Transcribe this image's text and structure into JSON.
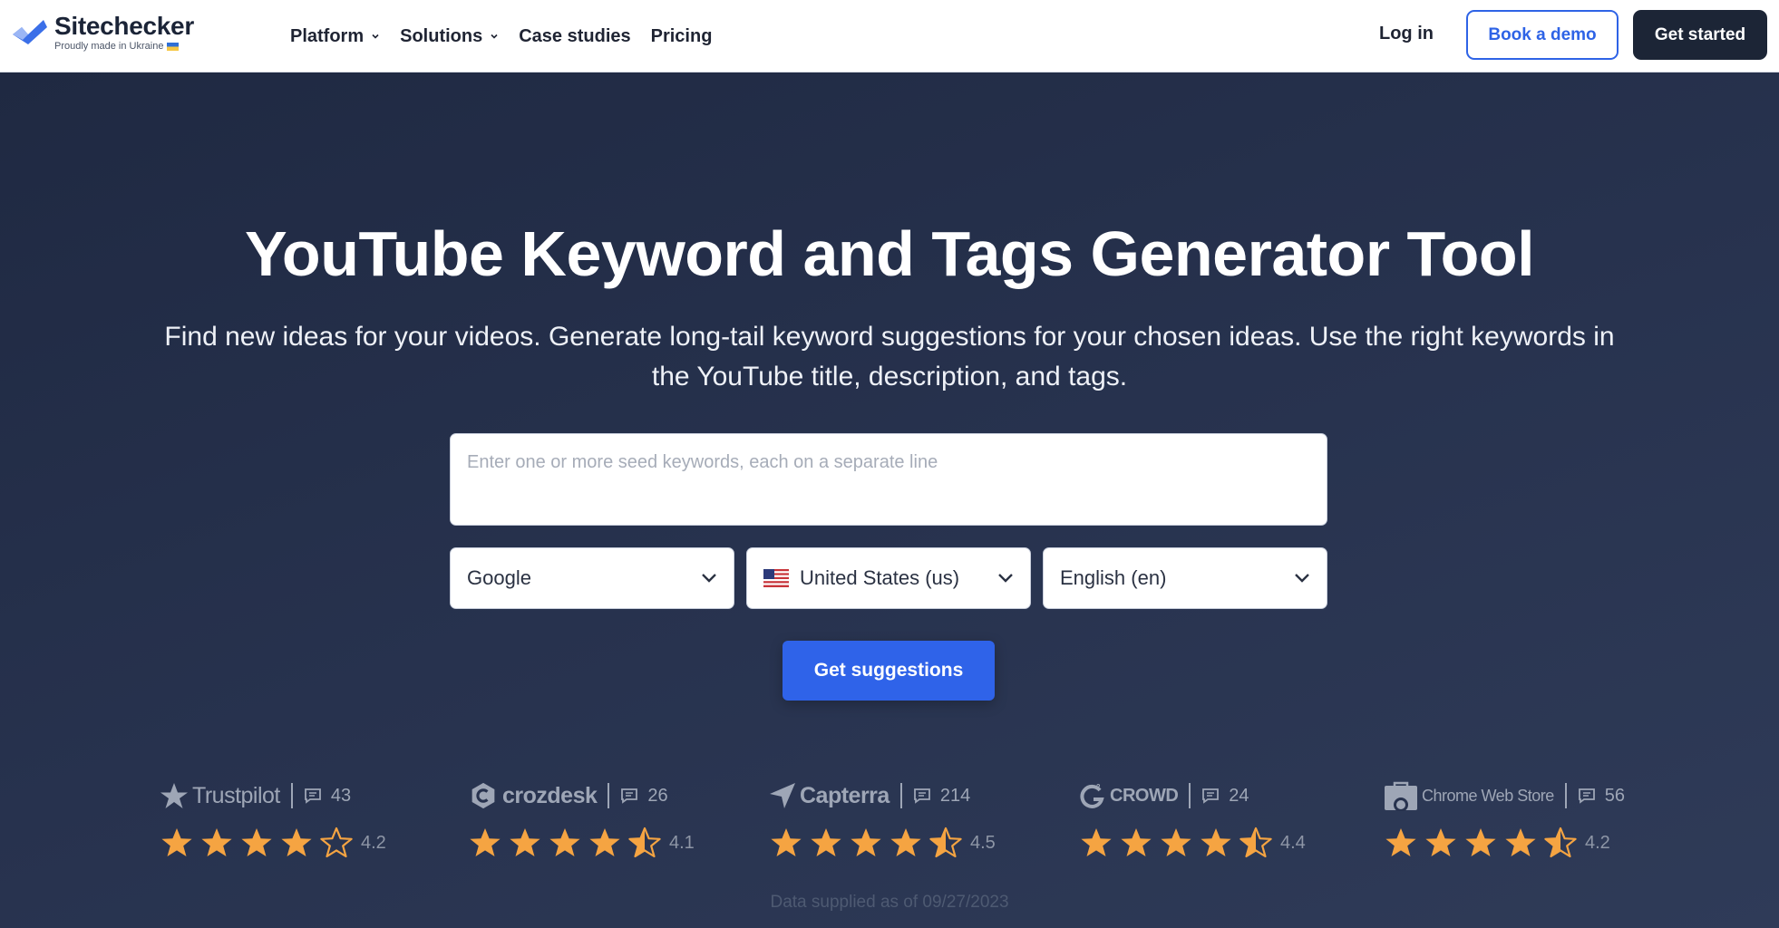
{
  "header": {
    "logo_title": "Sitechecker",
    "logo_tagline": "Proudly made in Ukraine",
    "nav": [
      {
        "label": "Platform",
        "has_dropdown": true
      },
      {
        "label": "Solutions",
        "has_dropdown": true
      },
      {
        "label": "Case studies",
        "has_dropdown": false
      },
      {
        "label": "Pricing",
        "has_dropdown": false
      }
    ],
    "login_label": "Log in",
    "demo_label": "Book a demo",
    "start_label": "Get started"
  },
  "hero": {
    "title": "YouTube Keyword and Tags Generator Tool",
    "subtitle": "Find new ideas for your videos. Generate long-tail keyword suggestions for your chosen ideas. Use the right keywords in the YouTube title, description, and tags.",
    "seed_placeholder": "Enter one or more seed keywords, each on a separate line",
    "engine_value": "Google",
    "country_value": "United States (us)",
    "language_value": "English (en)",
    "submit_label": "Get suggestions"
  },
  "ratings": [
    {
      "brand": "Trustpilot",
      "icon": "trustpilot-star-icon",
      "reviews": "43",
      "score": "4.2",
      "stars": 4.2
    },
    {
      "brand": "crozdesk",
      "icon": "crozdesk-logo-icon",
      "reviews": "26",
      "score": "4.1",
      "stars": 4.5
    },
    {
      "brand": "Capterra",
      "icon": "capterra-arrow-icon",
      "reviews": "214",
      "score": "4.5",
      "stars": 4.5
    },
    {
      "brand": "CROWD",
      "icon": "g2-logo-icon",
      "reviews": "24",
      "score": "4.4",
      "stars": 4.5
    },
    {
      "brand": "Chrome Web Store",
      "icon": "chrome-web-store-icon",
      "reviews": "56",
      "score": "4.2",
      "stars": 4.5
    }
  ],
  "supplied_note": "Data supplied as of 09/27/2023",
  "colors": {
    "brand_blue": "#2f63e9",
    "dark_navy": "#1c2536",
    "star_orange": "#f5a442",
    "hero_bg": "#27324e"
  }
}
